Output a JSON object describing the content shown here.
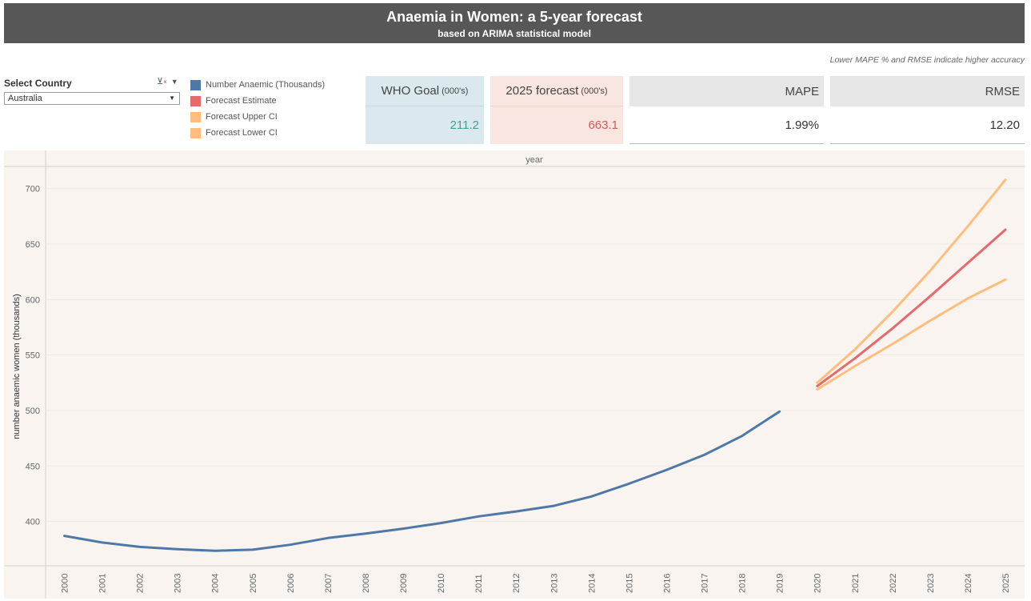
{
  "header": {
    "title": "Anaemia in Women: a 5-year forecast",
    "subtitle": "based on ARIMA  statistical model"
  },
  "note": "Lower MAPE % and RMSE indicate higher accuracy",
  "filter": {
    "label": "Select Country",
    "value": "Australia",
    "icon": "filter-clear-icon"
  },
  "legend": [
    {
      "label": "Number Anaemic (Thousands)",
      "color": "#4e79a7"
    },
    {
      "label": "Forecast Estimate",
      "color": "#e8696b"
    },
    {
      "label": "Forecast Upper CI",
      "color": "#ffbe7d"
    },
    {
      "label": "Forecast Lower CI",
      "color": "#ffbe7d"
    }
  ],
  "kpis": {
    "who": {
      "label": "WHO Goal",
      "unit": "(000's)",
      "value": "211.2"
    },
    "forecast": {
      "label": "2025 forecast",
      "unit": "(000's)",
      "value": "663.1"
    },
    "mape": {
      "label": "MAPE",
      "value": "1.99%"
    },
    "rmse": {
      "label": "RMSE",
      "value": "12.20"
    }
  },
  "chart_data": {
    "type": "line",
    "xlabel": "year",
    "ylabel": "number anaemic women (thousands)",
    "ylim": [
      360,
      720
    ],
    "yticks": [
      400,
      450,
      500,
      550,
      600,
      650,
      700
    ],
    "x": [
      2000,
      2001,
      2002,
      2003,
      2004,
      2005,
      2006,
      2007,
      2008,
      2009,
      2010,
      2011,
      2012,
      2013,
      2014,
      2015,
      2016,
      2017,
      2018,
      2019,
      2020,
      2021,
      2022,
      2023,
      2024,
      2025
    ],
    "grid": true,
    "series": [
      {
        "name": "Number Anaemic (Thousands)",
        "color": "#4e79a7",
        "x": [
          2000,
          2001,
          2002,
          2003,
          2004,
          2005,
          2006,
          2007,
          2008,
          2009,
          2010,
          2011,
          2012,
          2013,
          2014,
          2015,
          2016,
          2017,
          2018,
          2019
        ],
        "values": [
          387,
          381,
          377,
          375,
          373.5,
          374.5,
          379,
          385,
          389,
          393.5,
          398.5,
          404.5,
          409,
          414,
          422.5,
          434,
          446.5,
          460,
          477,
          499
        ]
      },
      {
        "name": "Forecast Upper CI",
        "color": "#ffbe7d",
        "x": [
          2020,
          2021,
          2022,
          2023,
          2024,
          2025
        ],
        "values": [
          525,
          555,
          589,
          626,
          666,
          708
        ]
      },
      {
        "name": "Forecast Lower CI",
        "color": "#ffbe7d",
        "x": [
          2020,
          2021,
          2022,
          2023,
          2024,
          2025
        ],
        "values": [
          519,
          540,
          560,
          581,
          601,
          618
        ]
      },
      {
        "name": "Forecast Estimate",
        "color": "#e8696b",
        "x": [
          2020,
          2021,
          2022,
          2023,
          2024,
          2025
        ],
        "values": [
          522,
          547,
          574,
          603,
          633,
          663
        ]
      }
    ]
  }
}
